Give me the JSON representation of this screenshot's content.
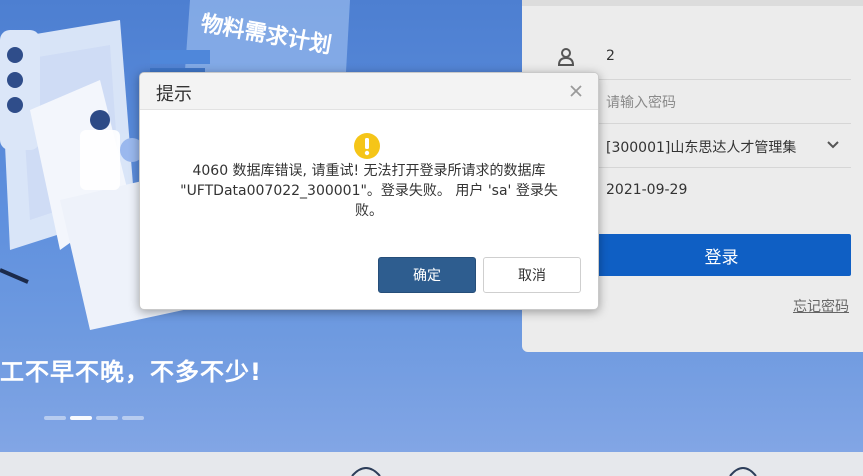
{
  "background": {
    "illustration_caption": "物料需求计划",
    "slogan": "工不早不晚，不多不少!",
    "carousel_dots": 4,
    "carousel_active": 2
  },
  "login": {
    "username_value": "2",
    "password_placeholder": "请输入密码",
    "account_set": "[300001]山东思达人才管理集",
    "date": "2021-09-29",
    "login_label": "登录",
    "forgot_label": "忘记密码"
  },
  "dialog": {
    "title": "提示",
    "message": "4060 数据库错误, 请重试! 无法打开登录所请求的数据库 \"UFTData007022_300001\"。登录失败。 用户 'sa' 登录失败。",
    "ok_label": "确定",
    "cancel_label": "取消"
  },
  "colors": {
    "login_button": "#0f5fc4",
    "ok_button": "#2e5d8f",
    "warning": "#f5c518"
  }
}
